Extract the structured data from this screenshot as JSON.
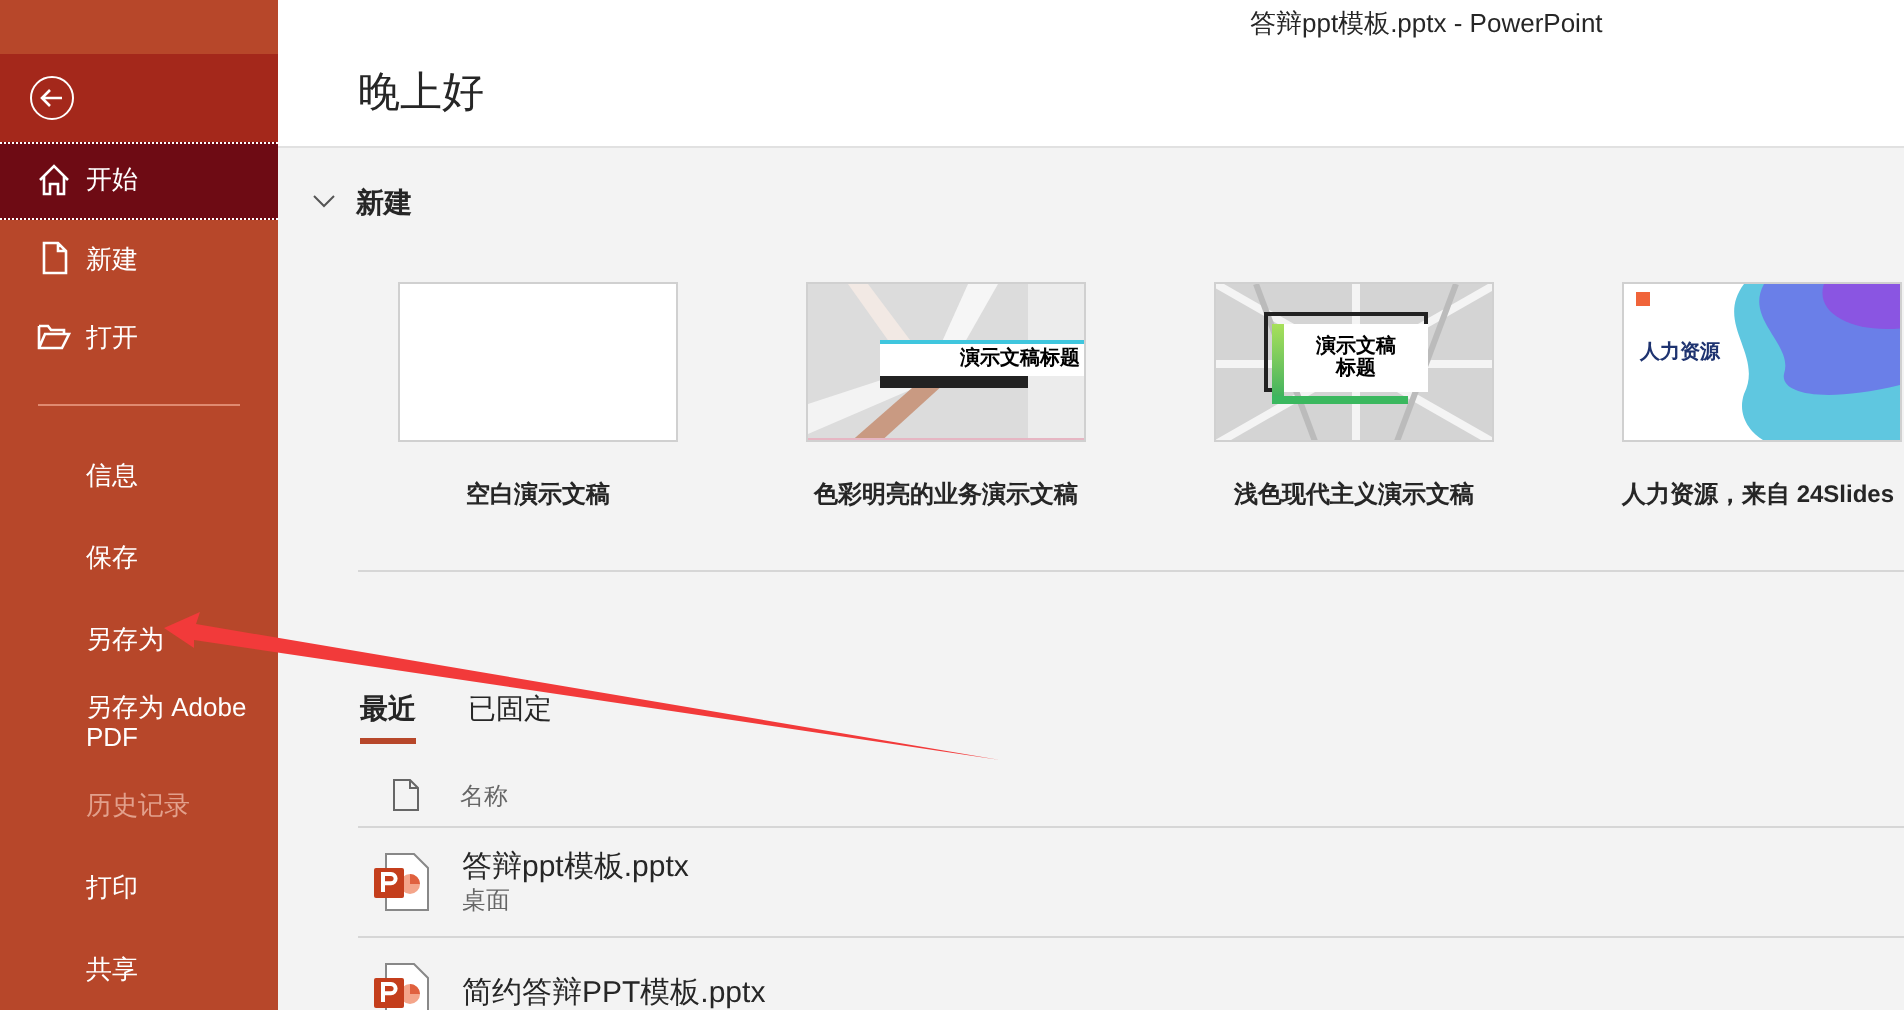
{
  "window": {
    "title": "答辩ppt模板.pptx  -  PowerPoint"
  },
  "sidebar": {
    "primary": [
      {
        "label": "开始",
        "kind": "home",
        "selected": true
      },
      {
        "label": "新建",
        "kind": "file",
        "selected": false
      },
      {
        "label": "打开",
        "kind": "folder",
        "selected": false
      }
    ],
    "secondary": [
      {
        "label": "信息",
        "disabled": false
      },
      {
        "label": "保存",
        "disabled": false
      },
      {
        "label": "另存为",
        "disabled": false
      },
      {
        "label": "另存为 Adobe PDF",
        "disabled": false
      },
      {
        "label": "历史记录",
        "disabled": true
      },
      {
        "label": "打印",
        "disabled": false
      },
      {
        "label": "共享",
        "disabled": false
      }
    ]
  },
  "greeting": "晚上好",
  "new_section": {
    "title": "新建",
    "expanded": true,
    "templates": [
      {
        "label": "空白演示文稿",
        "kind": "blank"
      },
      {
        "label": "色彩明亮的业务演示文稿",
        "kind": "hands",
        "preview_title": "演示文稿标题"
      },
      {
        "label": "浅色现代主义演示文稿",
        "kind": "frame",
        "preview_title": "演示文稿标题"
      },
      {
        "label": "人力资源，来自 24Slides",
        "kind": "wave",
        "preview_title": "人力资源"
      }
    ]
  },
  "recent": {
    "tabs": [
      {
        "label": "最近",
        "selected": true
      },
      {
        "label": "已固定",
        "selected": false
      }
    ],
    "column": "名称",
    "files": [
      {
        "name": "答辩ppt模板.pptx",
        "location": "桌面"
      },
      {
        "name": "简约答辩PPT模板.pptx"
      }
    ]
  }
}
